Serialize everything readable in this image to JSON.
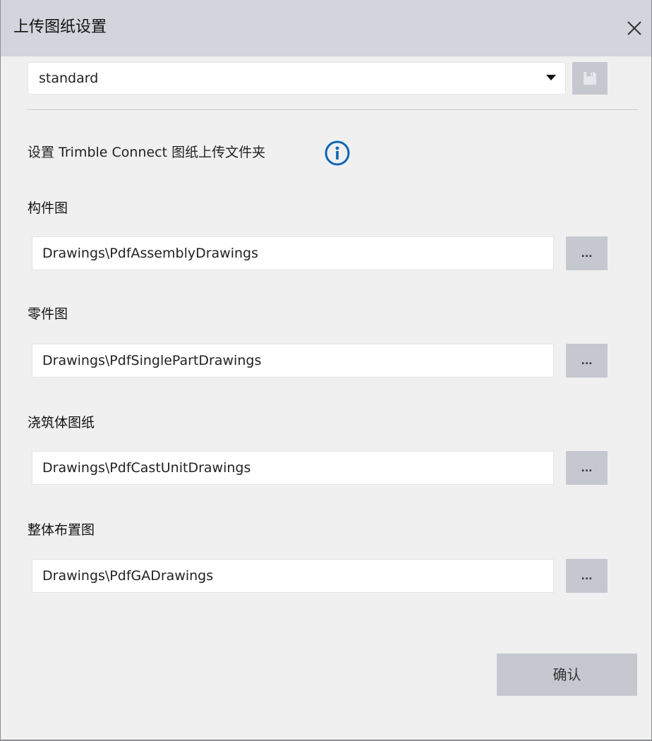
{
  "window": {
    "title": "上传图纸设置"
  },
  "preset": {
    "selected": "standard"
  },
  "info": {
    "text": "设置 Trimble Connect 图纸上传文件夹"
  },
  "fields": [
    {
      "label": "构件图",
      "value": "Drawings\\PdfAssemblyDrawings",
      "browse_label": "..."
    },
    {
      "label": "零件图",
      "value": "Drawings\\PdfSinglePartDrawings",
      "browse_label": "..."
    },
    {
      "label": "浇筑体图纸",
      "value": "Drawings\\PdfCastUnitDrawings",
      "browse_label": "..."
    },
    {
      "label": "整体布置图",
      "value": "Drawings\\PdfGADrawings",
      "browse_label": "..."
    }
  ],
  "footer": {
    "confirm_label": "确认"
  },
  "colors": {
    "accent": "#0a66b3",
    "button_bg": "#c5c8cf",
    "titlebar_bg": "#d2d5db",
    "dialog_bg": "#f0f0f1"
  },
  "icons": {
    "close": "close-icon",
    "caret": "caret-down-icon",
    "save": "save-icon",
    "info": "info-icon"
  }
}
